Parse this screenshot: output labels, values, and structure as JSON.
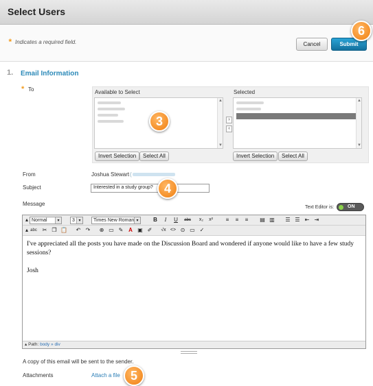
{
  "header": {
    "title": "Select Users"
  },
  "required_note": {
    "star": "*",
    "text": "Indicates a required field."
  },
  "buttons": {
    "cancel": "Cancel",
    "submit": "Submit"
  },
  "badges": {
    "b3": "3",
    "b4": "4",
    "b5": "5",
    "b6": "6"
  },
  "section": {
    "number": "1.",
    "title": "Email Information"
  },
  "to": {
    "label": "To",
    "star": "*",
    "available_label": "Available to Select",
    "selected_label": "Selected",
    "invert_label": "Invert Selection",
    "select_all_label": "Select All",
    "move_right": "›",
    "move_left": "‹"
  },
  "from": {
    "label": "From",
    "name": "Joshua Stewart",
    "email": "("
  },
  "subject": {
    "label": "Subject",
    "value": "Interested in a study group?"
  },
  "message": {
    "label": "Message",
    "text_editor_label": "Text Editor is:",
    "toggle_state": "ON",
    "format_value": "Normal",
    "size_value": "3",
    "font_value": "Times New Roman",
    "body_paragraph": "I've appreciated all the posts you have made on the Discussion Board and wondered if anyone would like to have a few study sessions?",
    "signature": "Josh",
    "path_label": "Path:",
    "path_body": "body",
    "path_sep": "»",
    "path_div": "div"
  },
  "copy_note": "A copy of this email will be sent to the sender.",
  "attachments": {
    "label": "Attachments",
    "link": "Attach a file"
  },
  "colors": {
    "accent": "#2b89b8",
    "submit": "#1a86b8",
    "badge": "#f08a1e",
    "required": "#f29c1f"
  }
}
